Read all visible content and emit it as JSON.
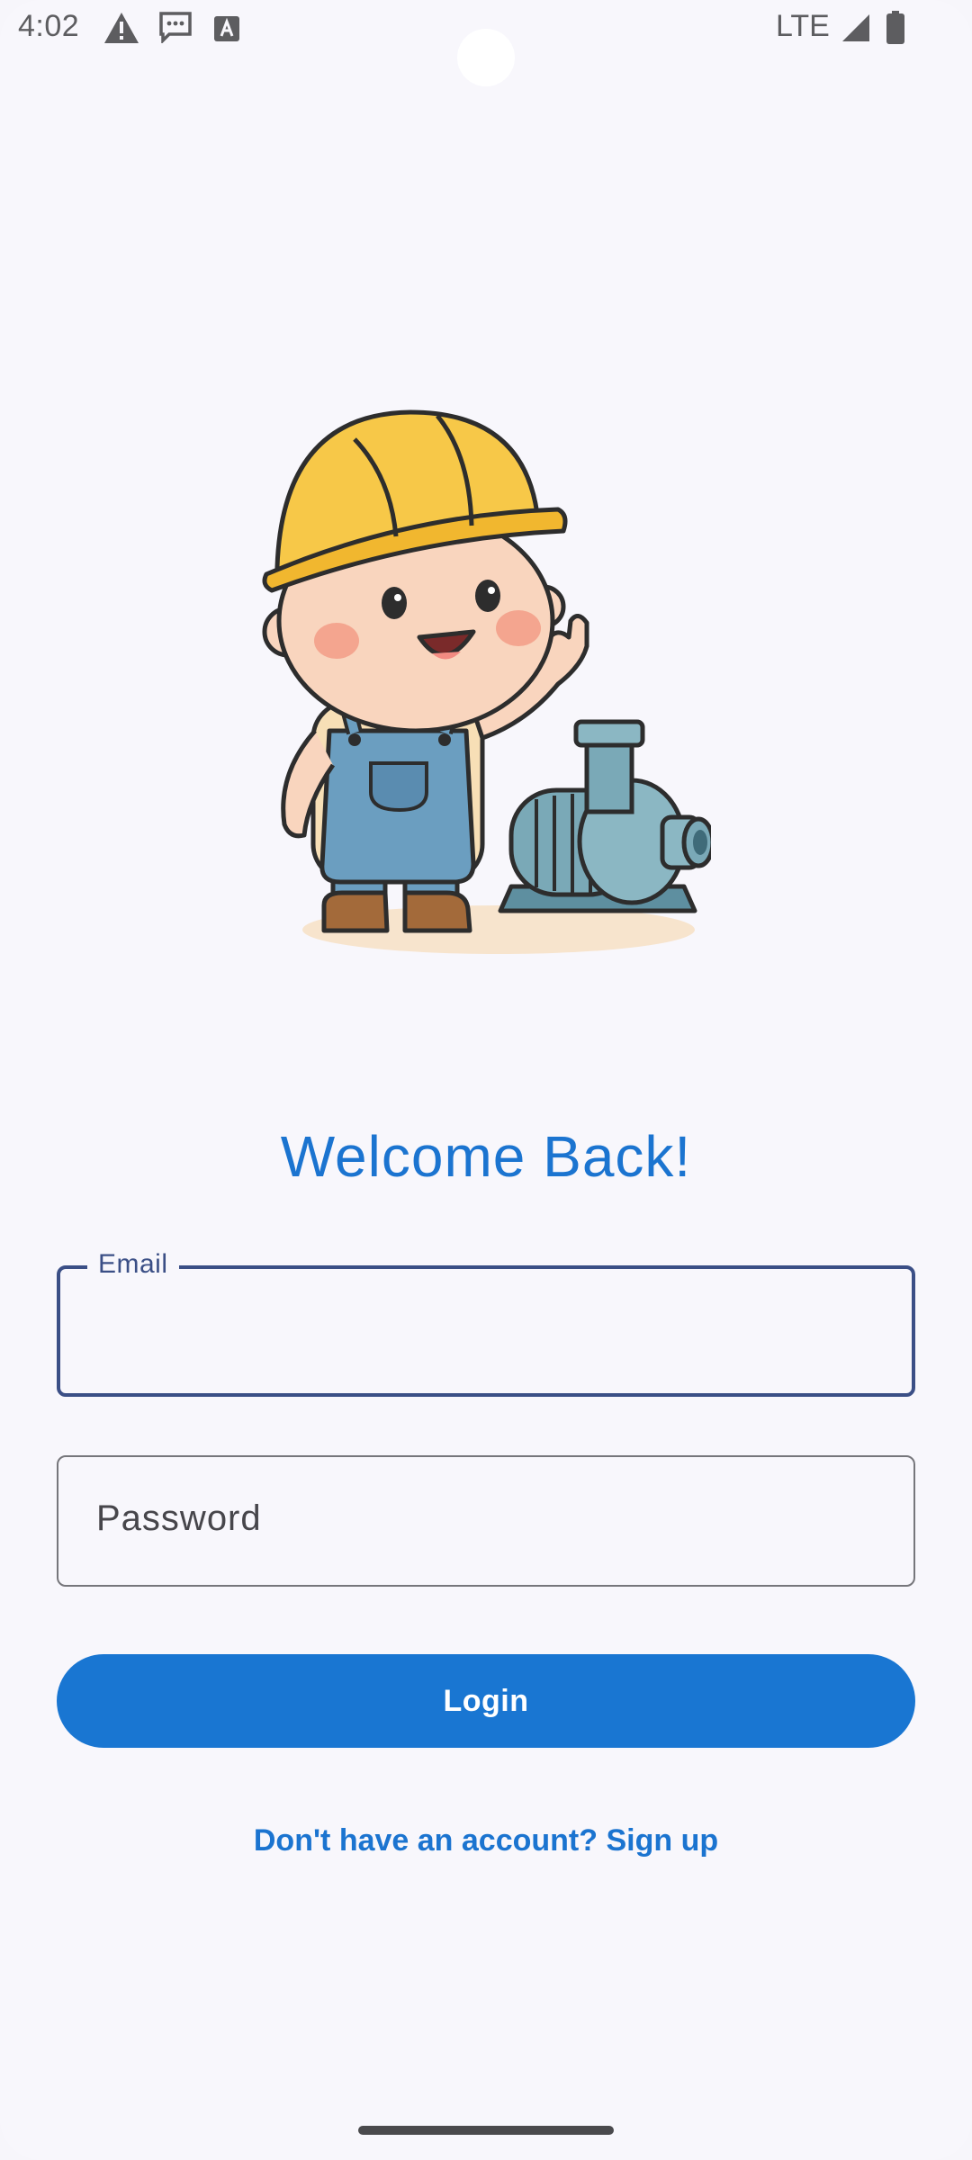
{
  "status_bar": {
    "time": "4:02",
    "network": "LTE",
    "icons": [
      "warning-icon",
      "message-icon",
      "text-a-icon",
      "signal-icon",
      "battery-icon"
    ]
  },
  "illustration": {
    "subject": "construction-worker-with-water-pump"
  },
  "login": {
    "title": "Welcome Back!",
    "email_label": "Email",
    "email_value": "",
    "password_placeholder": "Password",
    "login_label": "Login",
    "signup_text": "Don't have an account? Sign up"
  },
  "colors": {
    "primary": "#1976d2",
    "title": "#1b74d0",
    "focused_outline": "#3b4f86",
    "background": "#f8f7fc"
  }
}
